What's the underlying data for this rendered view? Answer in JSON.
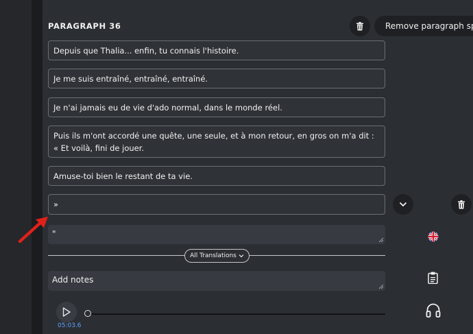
{
  "paragraph": {
    "title": "PARAGRAPH 36",
    "remove_label": "Remove paragraph space"
  },
  "sentences": [
    "Depuis que Thalia... enfin, tu connais l'histoire.",
    "Je me suis entraîné, entraîné, entraîné.",
    "Je n'ai jamais eu de vie d'ado normal, dans le monde réel.",
    "Puis ils m'ont accordé une quête, une seule, et à mon retour, en gros on m'a dit : « Et voilà, fini de jouer.",
    "Amuse-toi bien le restant de ta vie.",
    "»"
  ],
  "translation": {
    "value": "\""
  },
  "all_translations_label": "All Translations",
  "notes": {
    "placeholder": "Add notes"
  },
  "audio": {
    "time": "05:03.6",
    "progress": 0
  },
  "icons": {
    "delete": "trash-icon",
    "expand": "chevron-down-icon",
    "language": "uk-flag-icon",
    "clipboard": "clipboard-icon",
    "audio": "headphones-icon"
  },
  "colors": {
    "background": "#2b2e33",
    "field": "#373a40",
    "accent_time": "#5fa3ff",
    "annotation_arrow": "#e0201a"
  }
}
